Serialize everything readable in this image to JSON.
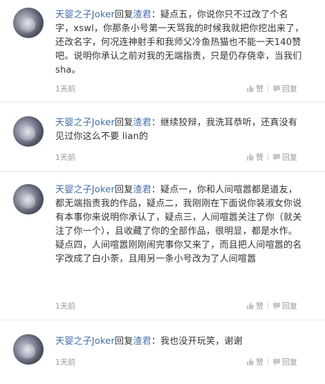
{
  "comments": [
    {
      "user": "天婴之子Joker",
      "reply_word": "回复",
      "target": "渣君",
      "content": "：疑点五，你说你只不过改了个名字，xswl，你那条小号第一天骂我的时候我就把你挖出来了，还改名字，何况连神射手和我师父冷鱼热猫也不能一天140赞吧。说明你承认之前对我的无端指责，只是仍存侥幸，当我们sha。",
      "time": "1天前",
      "like_label": "赞",
      "reply_label": "回复"
    },
    {
      "user": "天婴之子Joker",
      "reply_word": "回复",
      "target": "渣君",
      "content": "：继续狡辩，我洗耳恭听，还真没有见过你这么不要 lian的",
      "time": "1天前",
      "like_label": "赞",
      "reply_label": "回复"
    },
    {
      "user": "天婴之子Joker",
      "reply_word": "回复",
      "target": "渣君",
      "content": "：疑点一，你和人间喧嚣都是道友，都无端指责我的作品，疑点二，我刚刚在下面说你装淑女你说有本事你来说明你承认了，疑点三，人间喧嚣关注了你（就关注了你一个），且收藏了你的全部作品，很明显，都是水作。疑点四，人间喧嚣刚刚闹完事你又来了，而且把人间喧嚣的名字改成了白小荼，且用另一条小号改为了人间喧嚣",
      "time": "1天前",
      "like_label": "赞",
      "reply_label": "回复"
    },
    {
      "user": "天婴之子Joker",
      "reply_word": "回复",
      "target": "渣君",
      "content": "：我也没开玩笑，谢谢",
      "time": "1天前",
      "like_label": "赞",
      "reply_label": "回复"
    }
  ]
}
